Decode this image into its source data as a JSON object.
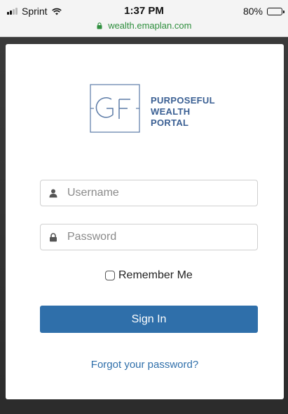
{
  "status_bar": {
    "carrier": "Sprint",
    "time": "1:37 PM",
    "battery": "80%",
    "battery_level": 0.8,
    "url": "wealth.emaplan.com"
  },
  "logo": {
    "line1": "PURPOSEFUL",
    "line2": "WEALTH",
    "line3": "PORTAL"
  },
  "form": {
    "username_placeholder": "Username",
    "password_placeholder": "Password",
    "remember_label": "Remember Me",
    "signin_label": "Sign In",
    "forgot_link": "Forgot your password?"
  },
  "icons": {
    "username": "user-icon",
    "password": "lock-icon",
    "url_lock": "lock-icon"
  },
  "colors": {
    "accent": "#2f6faa",
    "logo": "#3a5f93",
    "url": "#2f8f3e"
  }
}
